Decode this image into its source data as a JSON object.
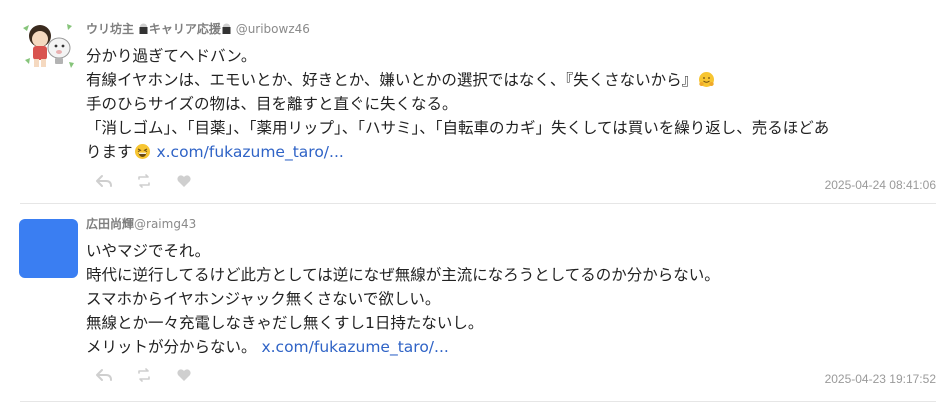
{
  "posts": [
    {
      "author_name": "ウリ坊主",
      "author_tag": "キャリア応援",
      "handle": "@uribowz46",
      "avatar_icon": "cartoon-avatar-icon",
      "lines": [
        "分かり過ぎてヘドバン。",
        "有線イヤホンは、エモいとか、好きとか、嫌いとかの選択ではなく、『失くさないから』",
        "手のひらサイズの物は、目を離すと直ぐに失くなる。",
        "「消しゴム」、「目薬」、「薬用リップ」、「ハサミ」、「自転車のカギ」失くしては買いを繰り返し、売るほどあ",
        "ります"
      ],
      "link": "x.com/fukazume_taro/...",
      "timestamp": "2025-04-24 08:41:06"
    },
    {
      "author_name": "広田尚輝",
      "handle": "@raimg43",
      "avatar_color": "#3a7ef2",
      "lines": [
        "いやマジでそれ。",
        "時代に逆行してるけど此方としては逆になぜ無線が主流になろうとしてるのか分からない。",
        "スマホからイヤホンジャック無くさないで欲しい。",
        "無線とか一々充電しなきゃだし無くすし1日持たないし。",
        "メリットが分からない。"
      ],
      "link": "x.com/fukazume_taro/...",
      "timestamp": "2025-04-23 19:17:52"
    }
  ],
  "actions": [
    "reply-icon",
    "retweet-icon",
    "like-icon"
  ],
  "colors": {
    "link": "#2f63c6",
    "meta": "#9a9a9a",
    "action": "#d0d0d0"
  }
}
